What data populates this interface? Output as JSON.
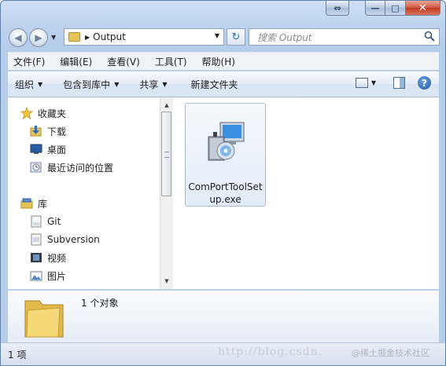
{
  "window": {
    "caption": {
      "back_glyph": "⇔",
      "min_glyph": "—",
      "max_glyph": "□",
      "close_glyph": "✕"
    }
  },
  "address": {
    "path": "Output",
    "search_placeholder": "搜索 Output"
  },
  "menu": [
    "文件(F)",
    "编辑(E)",
    "查看(V)",
    "工具(T)",
    "帮助(H)"
  ],
  "commands": {
    "organize": "组织",
    "include": "包含到库中",
    "share": "共享",
    "new_folder": "新建文件夹"
  },
  "nav": {
    "favorites": "收藏夹",
    "downloads": "下载",
    "desktop": "桌面",
    "recent": "最近访问的位置",
    "libraries": "库",
    "git": "Git",
    "subversion": "Subversion",
    "videos": "视频",
    "pictures": "图片"
  },
  "files": [
    {
      "name": "ComPortToolSetup.exe"
    }
  ],
  "details": {
    "count": "1 个对象"
  },
  "status": {
    "count": "1 项"
  },
  "watermark": {
    "url": "http://blog.csdn.",
    "site": "@稀土掘金技术社区"
  },
  "colors": {
    "accent": "#2f6fb6",
    "close": "#c1391f",
    "folder": "#e7c45a"
  }
}
